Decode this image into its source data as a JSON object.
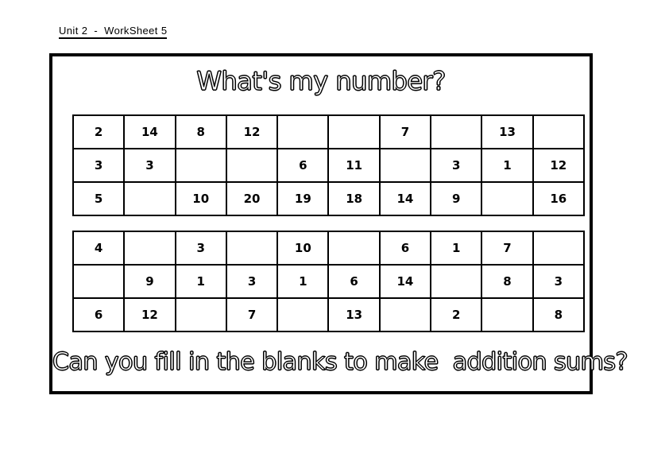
{
  "header": {
    "text": "Unit 2  -  WorkSheet 5"
  },
  "sheet": {
    "title": "What's my number?",
    "question": "Can you fill in the blanks to make  addition sums?"
  },
  "grids": [
    {
      "name": "number-grid-1",
      "rows": [
        [
          "2",
          "14",
          "8",
          "12",
          "",
          "",
          "7",
          "",
          "13",
          ""
        ],
        [
          "3",
          "3",
          "",
          "",
          "6",
          "11",
          "",
          "3",
          "1",
          "12"
        ],
        [
          "5",
          "",
          "10",
          "20",
          "19",
          "18",
          "14",
          "9",
          "",
          "16"
        ]
      ]
    },
    {
      "name": "number-grid-2",
      "rows": [
        [
          "4",
          "",
          "3",
          "",
          "10",
          "",
          "6",
          "1",
          "7",
          ""
        ],
        [
          "",
          "9",
          "1",
          "3",
          "1",
          "6",
          "14",
          "",
          "8",
          "3"
        ],
        [
          "6",
          "12",
          "",
          "7",
          "",
          "13",
          "",
          "2",
          "",
          "8"
        ]
      ]
    }
  ],
  "colors": {
    "ink": "#000000",
    "paper": "#ffffff"
  }
}
